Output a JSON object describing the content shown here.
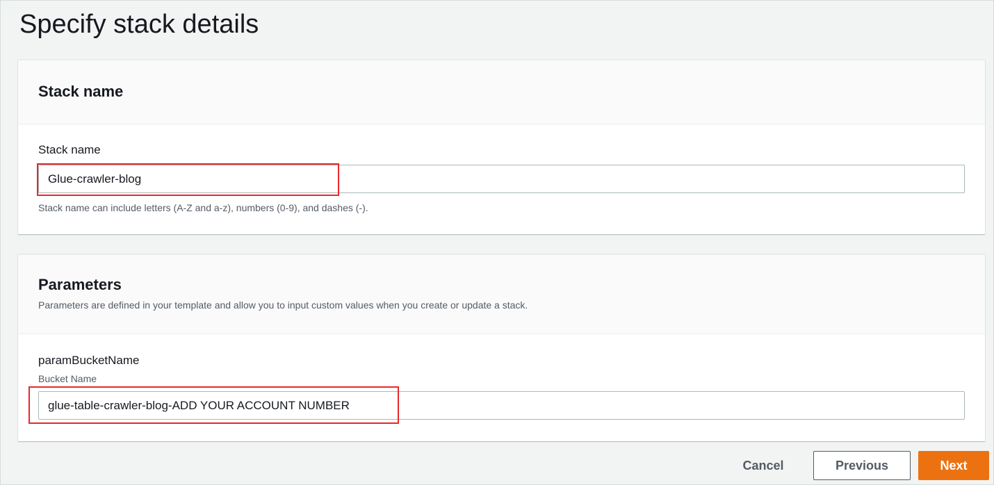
{
  "page": {
    "title": "Specify stack details"
  },
  "stack_section": {
    "header": "Stack name",
    "field_label": "Stack name",
    "input_value": "Glue-crawler-blog",
    "constraint_text": "Stack name can include letters (A-Z and a-z), numbers (0-9), and dashes (-)."
  },
  "parameters_section": {
    "header": "Parameters",
    "description": "Parameters are defined in your template and allow you to input custom values when you create or update a stack.",
    "params": [
      {
        "name": "paramBucketName",
        "description": "Bucket Name",
        "value": "glue-table-crawler-blog-ADD YOUR ACCOUNT NUMBER"
      }
    ]
  },
  "footer": {
    "cancel_label": "Cancel",
    "previous_label": "Previous",
    "next_label": "Next"
  },
  "colors": {
    "primary_button": "#ec7211",
    "highlight_box": "#e8272b",
    "background": "#f2f3f3"
  }
}
